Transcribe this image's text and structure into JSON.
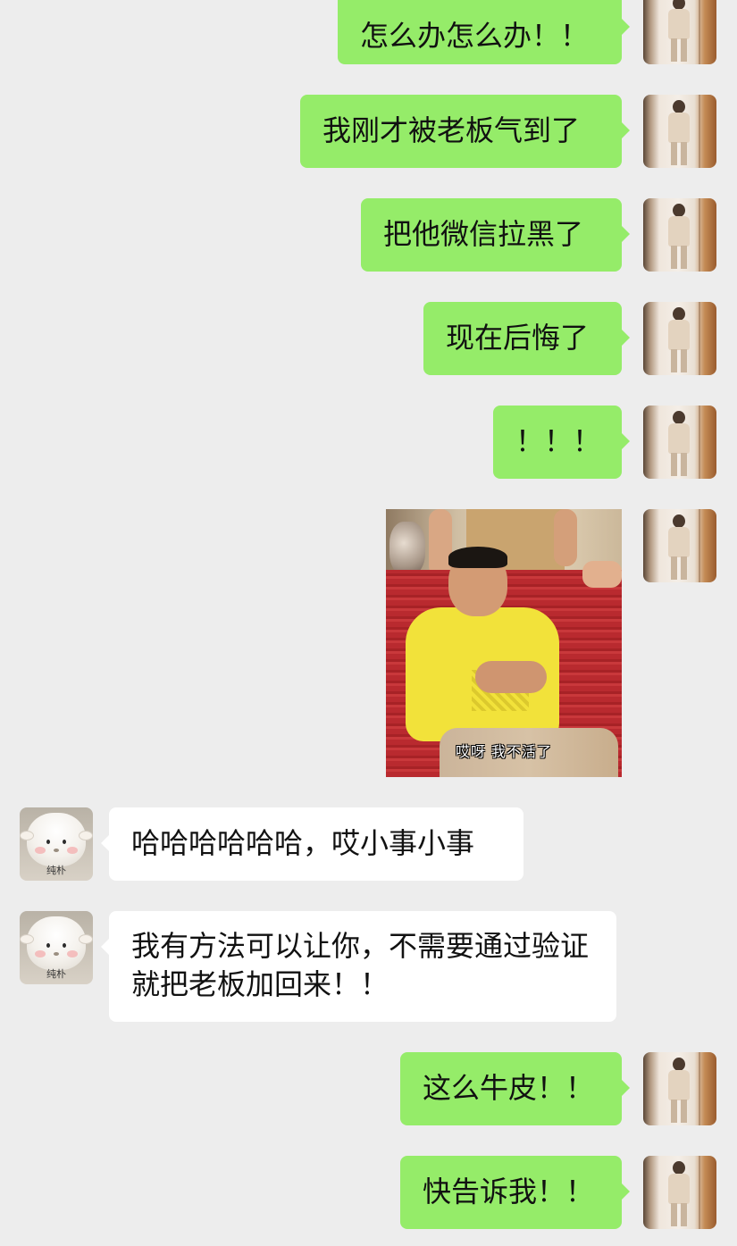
{
  "colors": {
    "chat_background": "#ededed",
    "self_bubble": "#95ec69",
    "other_bubble": "#ffffff",
    "text": "#111111"
  },
  "messages": [
    {
      "sender": "self",
      "type": "text",
      "text": "怎么办怎么办！！"
    },
    {
      "sender": "self",
      "type": "text",
      "text": "我刚才被老板气到了"
    },
    {
      "sender": "self",
      "type": "text",
      "text": "把他微信拉黑了"
    },
    {
      "sender": "self",
      "type": "text",
      "text": "现在后悔了"
    },
    {
      "sender": "self",
      "type": "text",
      "text": "！！！"
    },
    {
      "sender": "self",
      "type": "sticker",
      "caption": "哎呀 我不活了"
    },
    {
      "sender": "other",
      "type": "text",
      "text": "哈哈哈哈哈哈，哎小事小事"
    },
    {
      "sender": "other",
      "type": "text",
      "text": "我有方法可以让你，不需要通过验证就把老板加回来！！"
    },
    {
      "sender": "self",
      "type": "text",
      "text": "这么牛皮！！"
    },
    {
      "sender": "self",
      "type": "text",
      "text": "快告诉我！！"
    }
  ],
  "contact": {
    "avatar_caption": "纯朴"
  }
}
